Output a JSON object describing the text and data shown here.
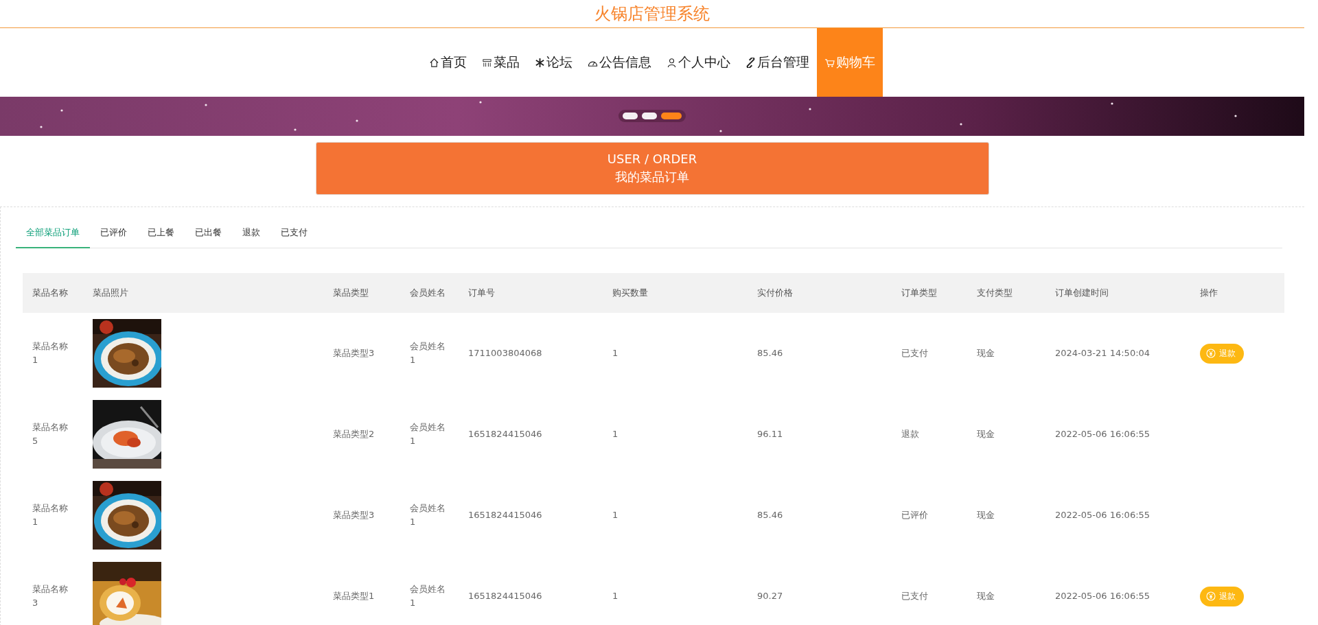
{
  "site_title": "火锅店管理系统",
  "nav": [
    {
      "label": "首页",
      "selected": false
    },
    {
      "label": "菜品",
      "selected": false
    },
    {
      "label": "论坛",
      "selected": false
    },
    {
      "label": "公告信息",
      "selected": false
    },
    {
      "label": "个人中心",
      "selected": false
    },
    {
      "label": "后台管理",
      "selected": false
    },
    {
      "label": "购物车",
      "selected": true
    }
  ],
  "banner": {
    "dots": [
      {
        "selected": false
      },
      {
        "selected": false
      },
      {
        "selected": true
      }
    ]
  },
  "section_heading": {
    "en": "USER / ORDER",
    "zh": "我的菜品订单"
  },
  "tabs": [
    {
      "label": "全部菜品订单",
      "selected": true
    },
    {
      "label": "已评价",
      "selected": false
    },
    {
      "label": "已上餐",
      "selected": false
    },
    {
      "label": "已出餐",
      "selected": false
    },
    {
      "label": "退款",
      "selected": false
    },
    {
      "label": "已支付",
      "selected": false
    }
  ],
  "table": {
    "columns": [
      "菜品名称",
      "菜品照片",
      "菜品类型",
      "会员姓名",
      "订单号",
      "购买数量",
      "实付价格",
      "订单类型",
      "支付类型",
      "订单创建时间",
      "操作"
    ],
    "rows": [
      {
        "name": "菜品名称1",
        "photo": {
          "kind": "noodles"
        },
        "type": "菜品类型3",
        "member": "会员姓名1",
        "order_no": "1711003804068",
        "quantity": "1",
        "price": "85.46",
        "order_type": "已支付",
        "pay_type": "现金",
        "created": "2024-03-21 14:50:04",
        "action": "退款"
      },
      {
        "name": "菜品名称5",
        "photo": {
          "kind": "shrimp"
        },
        "type": "菜品类型2",
        "member": "会员姓名1",
        "order_no": "1651824415046",
        "quantity": "1",
        "price": "96.11",
        "order_type": "退款",
        "pay_type": "现金",
        "created": "2022-05-06 16:06:55"
      },
      {
        "name": "菜品名称1",
        "photo": {
          "kind": "noodles"
        },
        "type": "菜品类型3",
        "member": "会员姓名1",
        "order_no": "1651824415046",
        "quantity": "1",
        "price": "85.46",
        "order_type": "已评价",
        "pay_type": "现金",
        "created": "2022-05-06 16:06:55"
      },
      {
        "name": "菜品名称3",
        "photo": {
          "kind": "cake"
        },
        "type": "菜品类型1",
        "member": "会员姓名1",
        "order_no": "1651824415046",
        "quantity": "1",
        "price": "90.27",
        "order_type": "已支付",
        "pay_type": "现金",
        "created": "2022-05-06 16:06:55",
        "action": "退款"
      }
    ]
  }
}
